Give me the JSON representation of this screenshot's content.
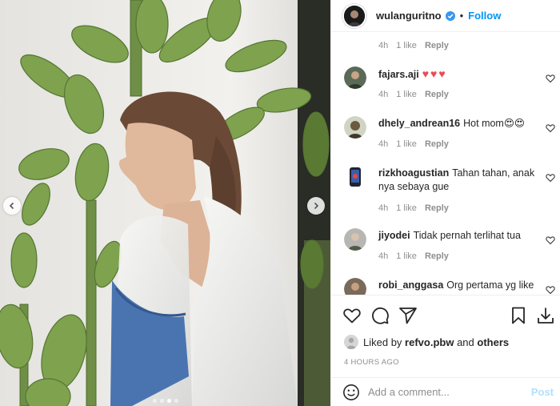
{
  "post": {
    "username": "wulanguritno",
    "separator": "•",
    "follow_label": "Follow",
    "carousel": {
      "slide_count": 4,
      "active_index": 2
    }
  },
  "comments": [
    {
      "username": "",
      "text": "",
      "time": "4h",
      "likes": "1 like",
      "reply": "Reply",
      "partial": true
    },
    {
      "username": "fajars.aji",
      "text": "♥♥♥",
      "time": "4h",
      "likes": "1 like",
      "reply": "Reply"
    },
    {
      "username": "dhely_andrean16",
      "text": "Hot mom😍😍",
      "time": "4h",
      "likes": "1 like",
      "reply": "Reply"
    },
    {
      "username": "rizkhoagustian",
      "text": "Tahan tahan, anak nya sebaya gue",
      "time": "4h",
      "likes": "1 like",
      "reply": "Reply"
    },
    {
      "username": "jiyodei",
      "text": "Tidak pernah terlihat tua",
      "time": "4h",
      "likes": "1 like",
      "reply": "Reply"
    },
    {
      "username": "robi_anggasa",
      "text": "Org pertama yg like",
      "partial": true
    }
  ],
  "likes": {
    "prefix": "Liked by",
    "user": "refvo.pbw",
    "and": "and",
    "others": "others"
  },
  "time_ago": "4 HOURS AGO",
  "add_comment": {
    "placeholder": "Add a comment...",
    "post_label": "Post"
  },
  "colors": {
    "accent": "#0095f6",
    "text": "#262626",
    "muted": "#8e8e8e",
    "heart": "#ed4956"
  },
  "icons": [
    "chevron-left-icon",
    "chevron-right-icon",
    "verified-badge-icon",
    "heart-icon",
    "comment-icon",
    "share-icon",
    "bookmark-icon",
    "download-icon",
    "emoji-icon",
    "small-heart-icon"
  ]
}
